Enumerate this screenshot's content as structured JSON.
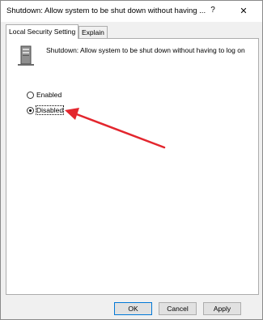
{
  "window": {
    "title": "Shutdown: Allow system to be shut down without having ...",
    "help_glyph": "?",
    "close_glyph": "✕"
  },
  "tabs": [
    {
      "label": "Local Security Setting",
      "active": true
    },
    {
      "label": "Explain",
      "active": false
    }
  ],
  "policy": {
    "name": "Shutdown: Allow system to be shut down without having to log on",
    "icon": "policy-computer-icon"
  },
  "options": [
    {
      "label": "Enabled",
      "selected": false
    },
    {
      "label": "Disabled",
      "selected": true
    }
  ],
  "buttons": {
    "ok": "OK",
    "cancel": "Cancel",
    "apply": "Apply"
  },
  "colors": {
    "annotation_arrow": "#e3262e",
    "default_button_border": "#0078d7"
  }
}
